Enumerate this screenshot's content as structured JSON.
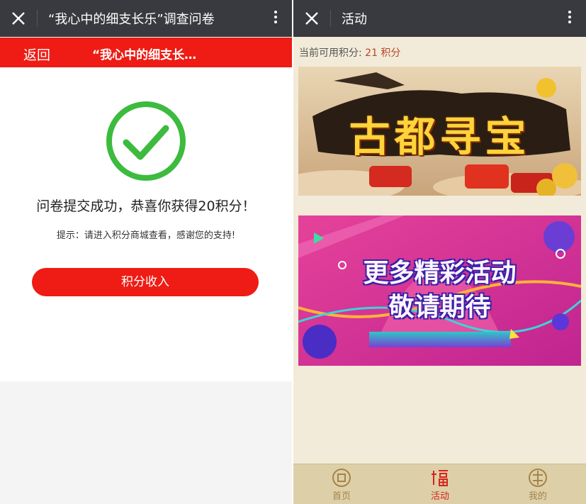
{
  "left": {
    "titlebar": {
      "title": "“我心中的细支长乐”调查问卷"
    },
    "nav": {
      "back_label": "返回",
      "title": "“我心中的细支长…"
    },
    "success": {
      "icon": "check-circle-icon",
      "message": "问卷提交成功，恭喜你获得20积分！",
      "tip": "提示：请进入积分商城查看，感谢您的支持!",
      "button_label": "积分收入"
    }
  },
  "right": {
    "titlebar": {
      "title": "活动"
    },
    "points": {
      "label": "当前可用积分:",
      "value": "21 积分"
    },
    "banners": [
      {
        "text": "古都寻宝"
      },
      {
        "line1": "更多精彩活动",
        "line2": "敬请期待"
      }
    ],
    "tabs": [
      {
        "label": "首页",
        "icon": "home-coin-icon"
      },
      {
        "label": "活动",
        "icon": "fu-character-icon",
        "active": true
      },
      {
        "label": "我的",
        "icon": "profile-seal-icon"
      }
    ]
  },
  "colors": {
    "accent_red": "#ee1c14",
    "success_green": "#3dbb3e",
    "titlebar": "#393a3f",
    "tab_gold": "#a6834a"
  }
}
